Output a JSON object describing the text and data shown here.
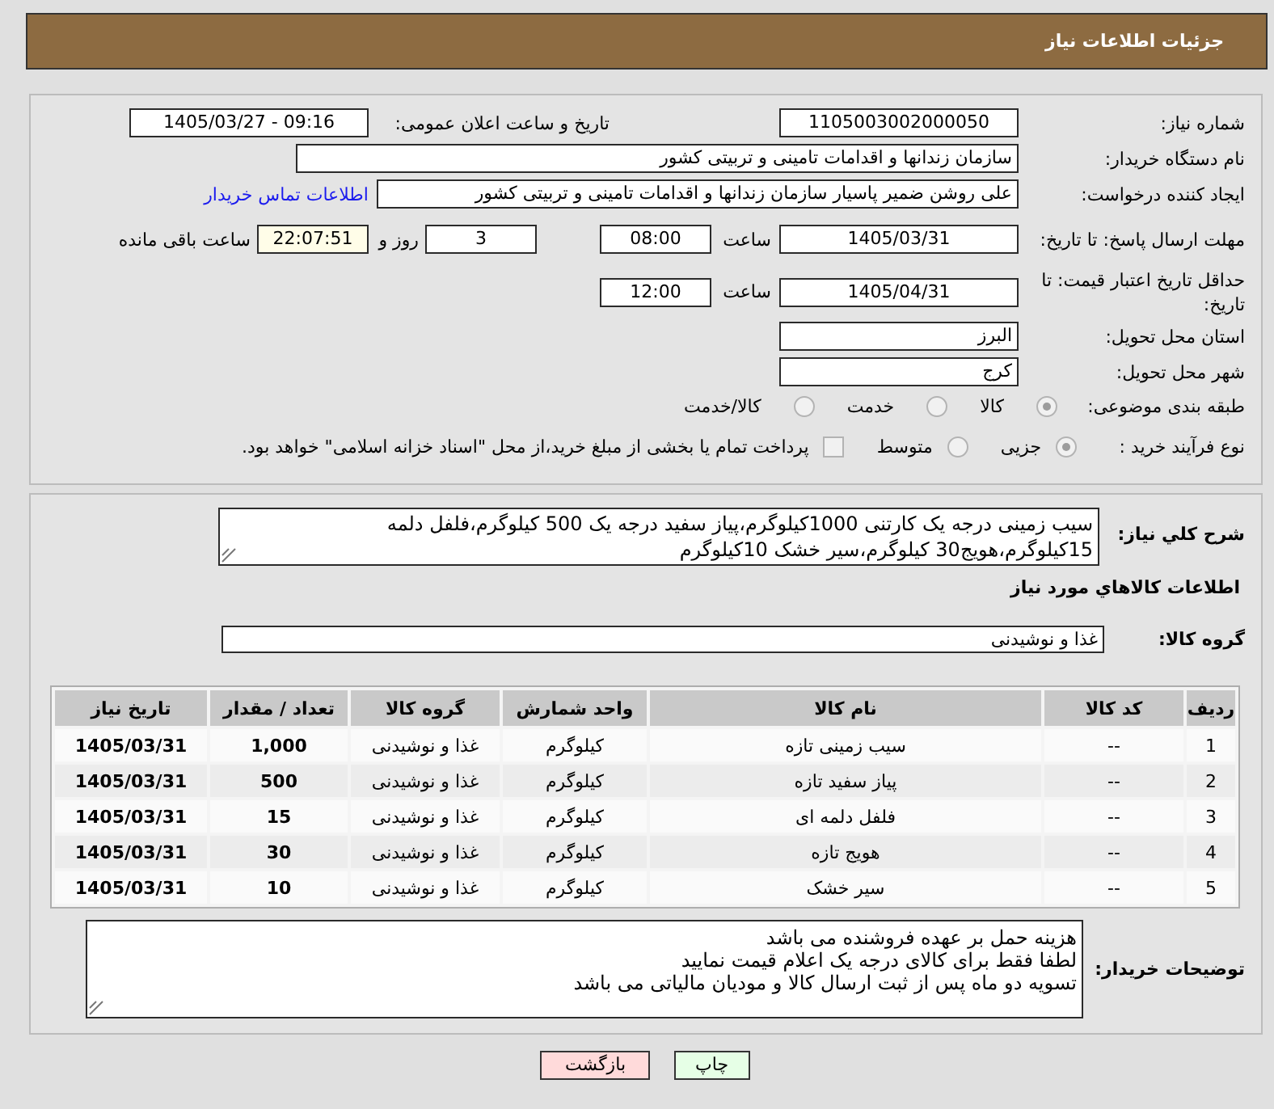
{
  "header": {
    "title": "جزئیات اطلاعات نیاز"
  },
  "details": {
    "need_number": {
      "label": "شماره نیاز:",
      "value": "1105003002000050"
    },
    "announce_datetime": {
      "label": "تاریخ و ساعت اعلان عمومی:",
      "value": "1405/03/27 - 09:16"
    },
    "buyer_org": {
      "label": "نام دستگاه خریدار:",
      "value": "سازمان زندانها و اقدامات تامینی و تربیتی کشور"
    },
    "requester": {
      "label": "ایجاد کننده درخواست:",
      "value": "علی روشن ضمیر پاسیار سازمان زندانها و اقدامات تامینی و تربیتی کشور",
      "contact_link": "اطلاعات تماس خریدار"
    },
    "response_deadline": {
      "label": "مهلت ارسال پاسخ: تا تاریخ:",
      "date": "1405/03/31",
      "time_label": "ساعت",
      "time": "08:00",
      "days": "3",
      "days_label": "روز و",
      "remaining_time": "22:07:51",
      "remaining_label": "ساعت باقی مانده"
    },
    "price_validity": {
      "label": "حداقل تاریخ اعتبار قیمت: تا تاریخ:",
      "date": "1405/04/31",
      "time_label": "ساعت",
      "time": "12:00"
    },
    "delivery_province": {
      "label": "استان محل تحویل:",
      "value": "البرز"
    },
    "delivery_city": {
      "label": "شهر محل تحویل:",
      "value": "کرج"
    },
    "subject_category": {
      "label": "طبقه بندی موضوعی:",
      "options": [
        {
          "label": "کالا",
          "selected": true
        },
        {
          "label": "خدمت",
          "selected": false
        },
        {
          "label": "کالا/خدمت",
          "selected": false
        }
      ]
    },
    "purchase_process": {
      "label": "نوع فرآیند خرید :",
      "options": [
        {
          "label": "جزیی",
          "selected": true
        },
        {
          "label": "متوسط",
          "selected": false
        }
      ],
      "treasury_payment": {
        "label": "پرداخت تمام یا بخشی از مبلغ خرید،از محل \"اسناد خزانه اسلامی\" خواهد بود.",
        "checked": false
      }
    }
  },
  "summary": {
    "label": "شرح کلي نياز:",
    "text": "سیب زمینی درجه یک کارتنی 1000کیلوگرم،پیاز سفید درجه یک 500 کیلوگرم،فلفل دلمه 15کیلوگرم،هویج30 کیلوگرم،سیر خشک 10کیلوگرم"
  },
  "items_title": "اطلاعات كالاهاي مورد نياز",
  "goods_group": {
    "label": "گروه کالا:",
    "value": "غذا و نوشیدنی"
  },
  "table": {
    "columns": [
      "ردیف",
      "کد کالا",
      "نام کالا",
      "واحد شمارش",
      "گروه کالا",
      "تعداد / مقدار",
      "تاریخ نیاز"
    ],
    "rows": [
      [
        "1",
        "--",
        "سیب زمینی تازه",
        "کیلوگرم",
        "غذا و نوشیدنی",
        "1,000",
        "1405/03/31"
      ],
      [
        "2",
        "--",
        "پیاز سفید تازه",
        "کیلوگرم",
        "غذا و نوشیدنی",
        "500",
        "1405/03/31"
      ],
      [
        "3",
        "--",
        "فلفل دلمه ای",
        "کیلوگرم",
        "غذا و نوشیدنی",
        "15",
        "1405/03/31"
      ],
      [
        "4",
        "--",
        "هویج تازه",
        "کیلوگرم",
        "غذا و نوشیدنی",
        "30",
        "1405/03/31"
      ],
      [
        "5",
        "--",
        "سیر خشک",
        "کیلوگرم",
        "غذا و نوشیدنی",
        "10",
        "1405/03/31"
      ]
    ]
  },
  "buyer_notes": {
    "label": "توضیحات خریدار:",
    "lines": [
      "هزینه حمل بر عهده فروشنده می باشد",
      "لطفا فقط برای کالای درجه یک اعلام قیمت نمایید",
      "تسویه دو ماه پس از ثبت ارسال کالا و مودیان مالیاتی می باشد"
    ]
  },
  "buttons": [
    {
      "label": "چاپ",
      "kind": "print"
    },
    {
      "label": "بازگشت",
      "kind": "back"
    }
  ]
}
